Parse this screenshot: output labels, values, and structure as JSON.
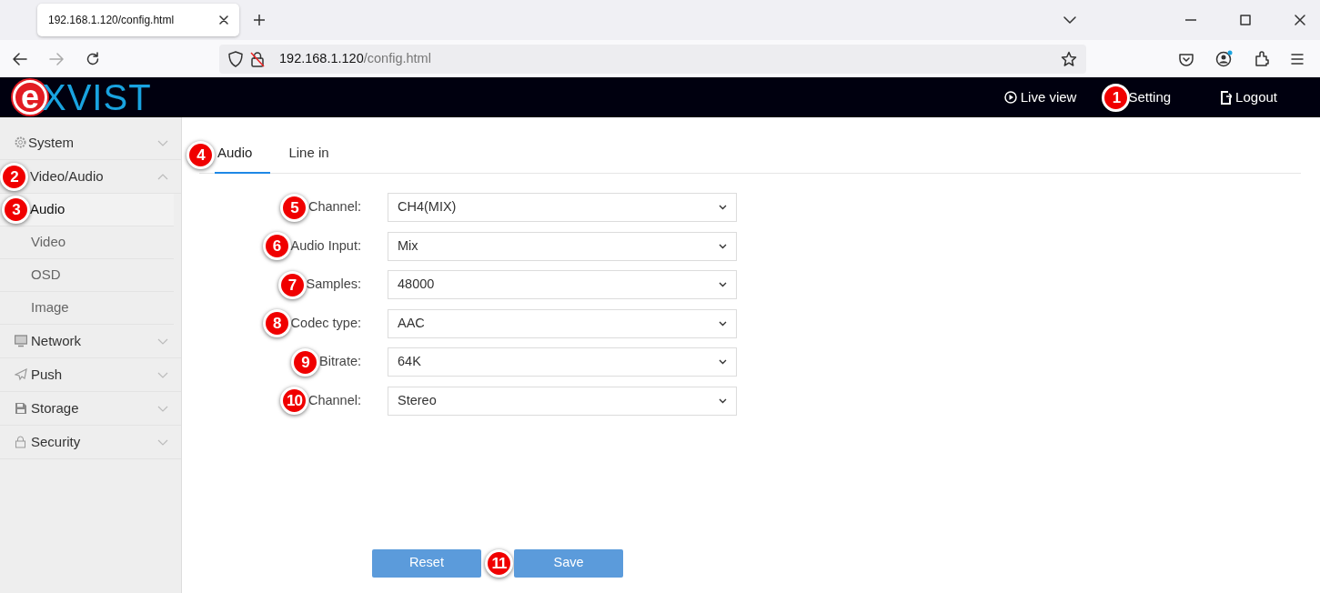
{
  "browser": {
    "tab_title": "192.168.1.120/config.html",
    "url_host": "192.168.1.120",
    "url_path": "/config.html"
  },
  "header": {
    "logo_mark": "e",
    "logo_text": "XVIST",
    "nav": [
      {
        "label": "Live view",
        "kind": "play"
      },
      {
        "label": "Setting",
        "kind": "plain",
        "callout": "1"
      },
      {
        "label": "Logout",
        "kind": "logout"
      }
    ]
  },
  "sidebar": {
    "items": [
      {
        "label": "System",
        "kind": "gear",
        "expanded": false
      },
      {
        "label": "Video/Audio",
        "kind": "plain",
        "expanded": true,
        "callout": "2",
        "children": [
          {
            "label": "Audio",
            "selected": true,
            "callout": "3"
          },
          {
            "label": "Video",
            "selected": false
          },
          {
            "label": "OSD",
            "selected": false
          },
          {
            "label": "Image",
            "selected": false
          }
        ]
      },
      {
        "label": "Network",
        "kind": "monitor",
        "expanded": false
      },
      {
        "label": "Push",
        "kind": "plane",
        "expanded": false
      },
      {
        "label": "Storage",
        "kind": "disk",
        "expanded": false
      },
      {
        "label": "Security",
        "kind": "lock",
        "expanded": false
      }
    ]
  },
  "tabs": [
    {
      "label": "Audio",
      "selected": true,
      "callout": "4"
    },
    {
      "label": "Line in",
      "selected": false
    }
  ],
  "fields": [
    {
      "label": "Channel:",
      "value": "CH4(MIX)",
      "callout": "5"
    },
    {
      "label": "Audio Input:",
      "value": "Mix",
      "callout": "6"
    },
    {
      "label": "Samples:",
      "value": "48000",
      "callout": "7"
    },
    {
      "label": "Codec type:",
      "value": "AAC",
      "callout": "8"
    },
    {
      "label": "Bitrate:",
      "value": "64K",
      "callout": "9"
    },
    {
      "label": "Channel:",
      "value": "Stereo",
      "callout": "10"
    }
  ],
  "buttons": [
    {
      "label": "Reset"
    },
    {
      "label": "Save",
      "callout": "11"
    }
  ]
}
